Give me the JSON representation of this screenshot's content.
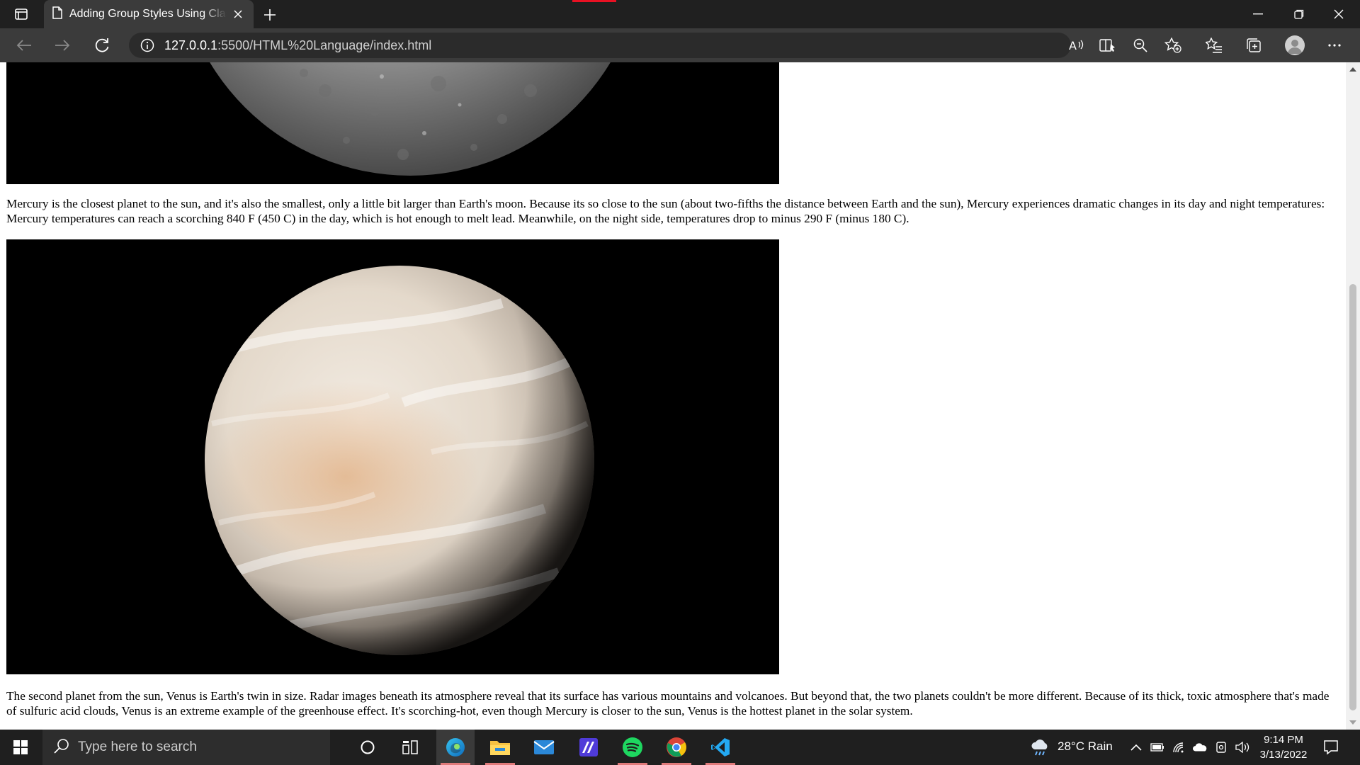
{
  "browser": {
    "tab_title": "Adding Group Styles Using Class",
    "url_host": "127.0.0.1",
    "url_rest": ":5500/HTML%20Language/index.html"
  },
  "page": {
    "mercury_text": "Mercury is the closest planet to the sun, and it's also the smallest, only a little bit larger than Earth's moon. Because its so close to the sun (about two-fifths the distance between Earth and the sun), Mercury experiences dramatic changes in its day and night temperatures: Mercury temperatures can reach a scorching 840 F (450 C) in the day, which is hot enough to melt lead. Meanwhile, on the night side, temperatures drop to minus 290 F (minus 180 C).",
    "venus_text": "The second planet from the sun, Venus is Earth's twin in size. Radar images beneath its atmosphere reveal that its surface has various mountains and volcanoes. But beyond that, the two planets couldn't be more different. Because of its thick, toxic atmosphere that's made of sulfuric acid clouds, Venus is an extreme example of the greenhouse effect. It's scorching-hot, even though Mercury is closer to the sun, Venus is the hottest planet in the solar system."
  },
  "taskbar": {
    "search_placeholder": "Type here to search",
    "weather": "28°C  Rain",
    "time": "9:14 PM",
    "date": "3/13/2022"
  },
  "colors": {
    "titlebar": "#202020",
    "toolbar": "#3b3b3b",
    "taskbar": "#1f1f1f",
    "spotify": "#1ed760",
    "edge_blue": "#0f7bd8",
    "vscode_blue": "#23a9f2"
  }
}
